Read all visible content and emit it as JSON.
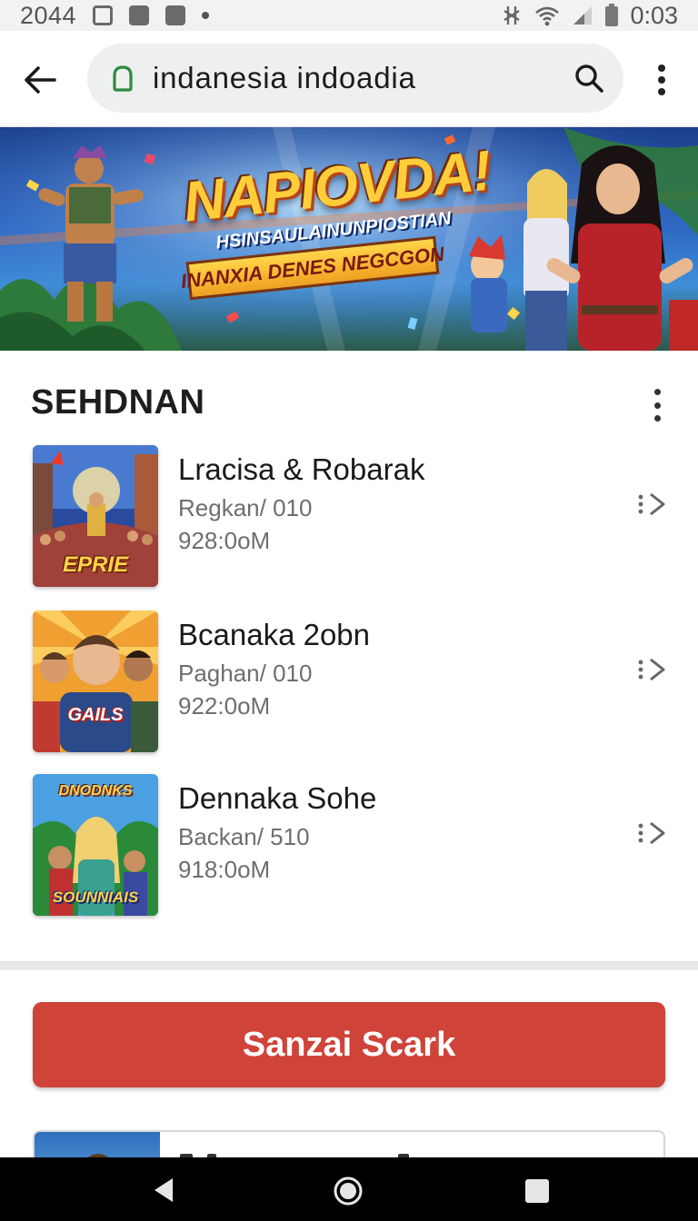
{
  "status_bar": {
    "time_left": "2044",
    "time_right": "0:03"
  },
  "browser": {
    "url": "indanesia  indoadia"
  },
  "banner": {
    "title": "NAPIOVDA!",
    "subtitle": "HSINSAULAINUNPIOSTIAN",
    "tagline": "INANXIA DENES NEGCGON"
  },
  "section": {
    "title": "SEHDNAN"
  },
  "games": [
    {
      "name": "Lracisa & Robarak",
      "meta1": "Regkan/ 010",
      "meta2": "928:0oM",
      "thumb_label": "EPRIE"
    },
    {
      "name": "Bcanaka 2obn",
      "meta1": "Paghan/ 010",
      "meta2": "922:0oM",
      "thumb_label": "GAILS"
    },
    {
      "name": "Dennaka Sohe",
      "meta1": "Backan/ 510",
      "meta2": "918:0oM",
      "thumb_label": "SOUNNIAIS",
      "thumb_top_label": "DNODNKS"
    }
  ],
  "cta": {
    "label": "Sanzai Scark"
  },
  "colors": {
    "accent": "#cf4339",
    "status_bar_bg": "#f2f2f2",
    "url_pill_bg": "#eef0ef",
    "lock_green": "#2e8b3e"
  },
  "icons": {
    "back": "arrow-left-icon",
    "lock": "lock-icon",
    "search": "search-icon",
    "menu": "more-vert-icon",
    "item_arrow": "chevron-right-dashed-icon",
    "nav_back": "triangle-back-icon",
    "nav_home": "circle-home-icon",
    "nav_recent": "square-recent-icon"
  }
}
